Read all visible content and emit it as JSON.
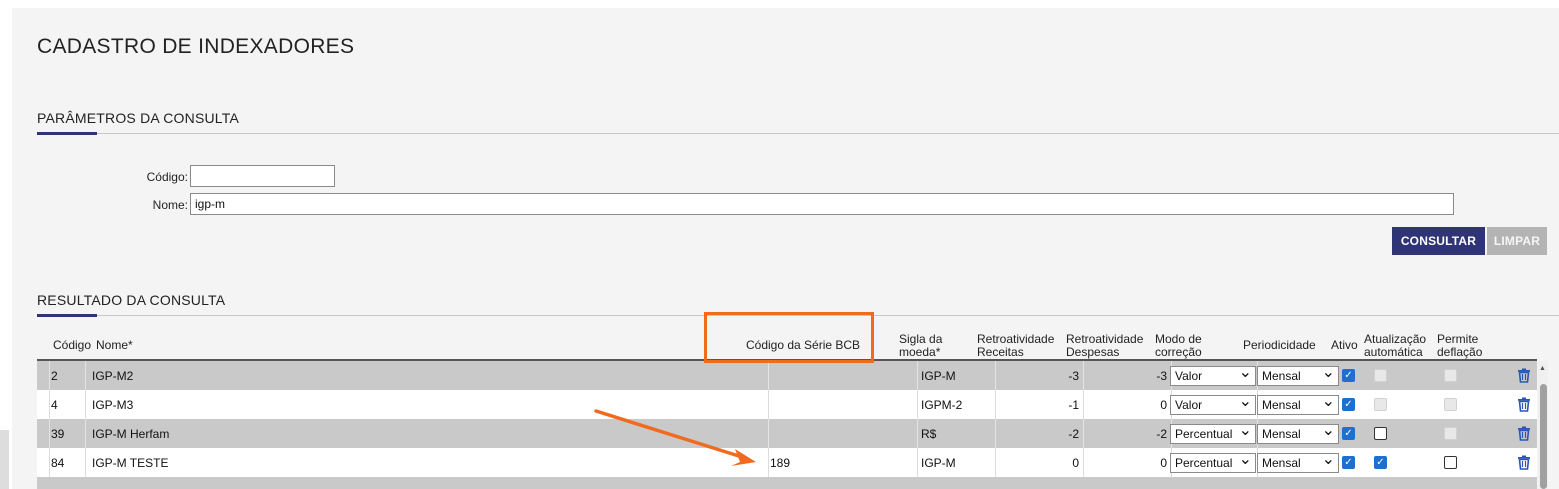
{
  "page": {
    "title": "CADASTRO DE INDEXADORES"
  },
  "params": {
    "section_title": "PARÂMETROS DA CONSULTA",
    "codigo_label": "Código:",
    "codigo_value": "",
    "nome_label": "Nome:",
    "nome_value": "igp-m",
    "consultar_label": "CONSULTAR",
    "limpar_label": "LIMPAR"
  },
  "results": {
    "section_title": "RESULTADO DA CONSULTA",
    "columns": {
      "codigo": "Código",
      "nome": "Nome*",
      "serie_bcb": "Código da Série BCB",
      "sigla_1": "Sigla da",
      "sigla_2": "moeda*",
      "retro_rec_1": "Retroatividade",
      "retro_rec_2": "Receitas",
      "retro_desp_1": "Retroatividade",
      "retro_desp_2": "Despesas",
      "modo_1": "Modo de",
      "modo_2": "correção",
      "periodicidade": "Periodicidade",
      "ativo": "Ativo",
      "atual_1": "Atualização",
      "atual_2": "automática",
      "deflacao_1": "Permite",
      "deflacao_2": "deflação"
    },
    "rows": [
      {
        "codigo": "2",
        "nome": "IGP-M2",
        "serie": "",
        "sigla": "IGP-M",
        "retro_rec": "-3",
        "retro_desp": "-3",
        "modo": "Valor",
        "periodicidade": "Mensal",
        "ativo": true,
        "atualizacao": "disabled",
        "deflacao": "disabled"
      },
      {
        "codigo": "4",
        "nome": "IGP-M3",
        "serie": "",
        "sigla": "IGPM-2",
        "retro_rec": "-1",
        "retro_desp": "0",
        "modo": "Valor",
        "periodicidade": "Mensal",
        "ativo": true,
        "atualizacao": "disabled",
        "deflacao": "disabled"
      },
      {
        "codigo": "39",
        "nome": "IGP-M Herfam",
        "serie": "",
        "sigla": "R$",
        "retro_rec": "-2",
        "retro_desp": "-2",
        "modo": "Percentual",
        "periodicidade": "Mensal",
        "ativo": true,
        "atualizacao": "unchecked",
        "deflacao": "disabled"
      },
      {
        "codigo": "84",
        "nome": "IGP-M TESTE",
        "serie": "189",
        "sigla": "IGP-M",
        "retro_rec": "0",
        "retro_desp": "0",
        "modo": "Percentual",
        "periodicidade": "Mensal",
        "ativo": true,
        "atualizacao": "checked",
        "deflacao": "unchecked"
      }
    ]
  },
  "icons": {
    "delete": "trash-icon",
    "dropdown": "chevron-down-icon",
    "checkbox": "check-icon"
  },
  "colors": {
    "primary": "#2e3475",
    "highlight": "#f06a1f",
    "checkbox": "#1f6fd1",
    "row_gray": "#c9c9c9"
  }
}
